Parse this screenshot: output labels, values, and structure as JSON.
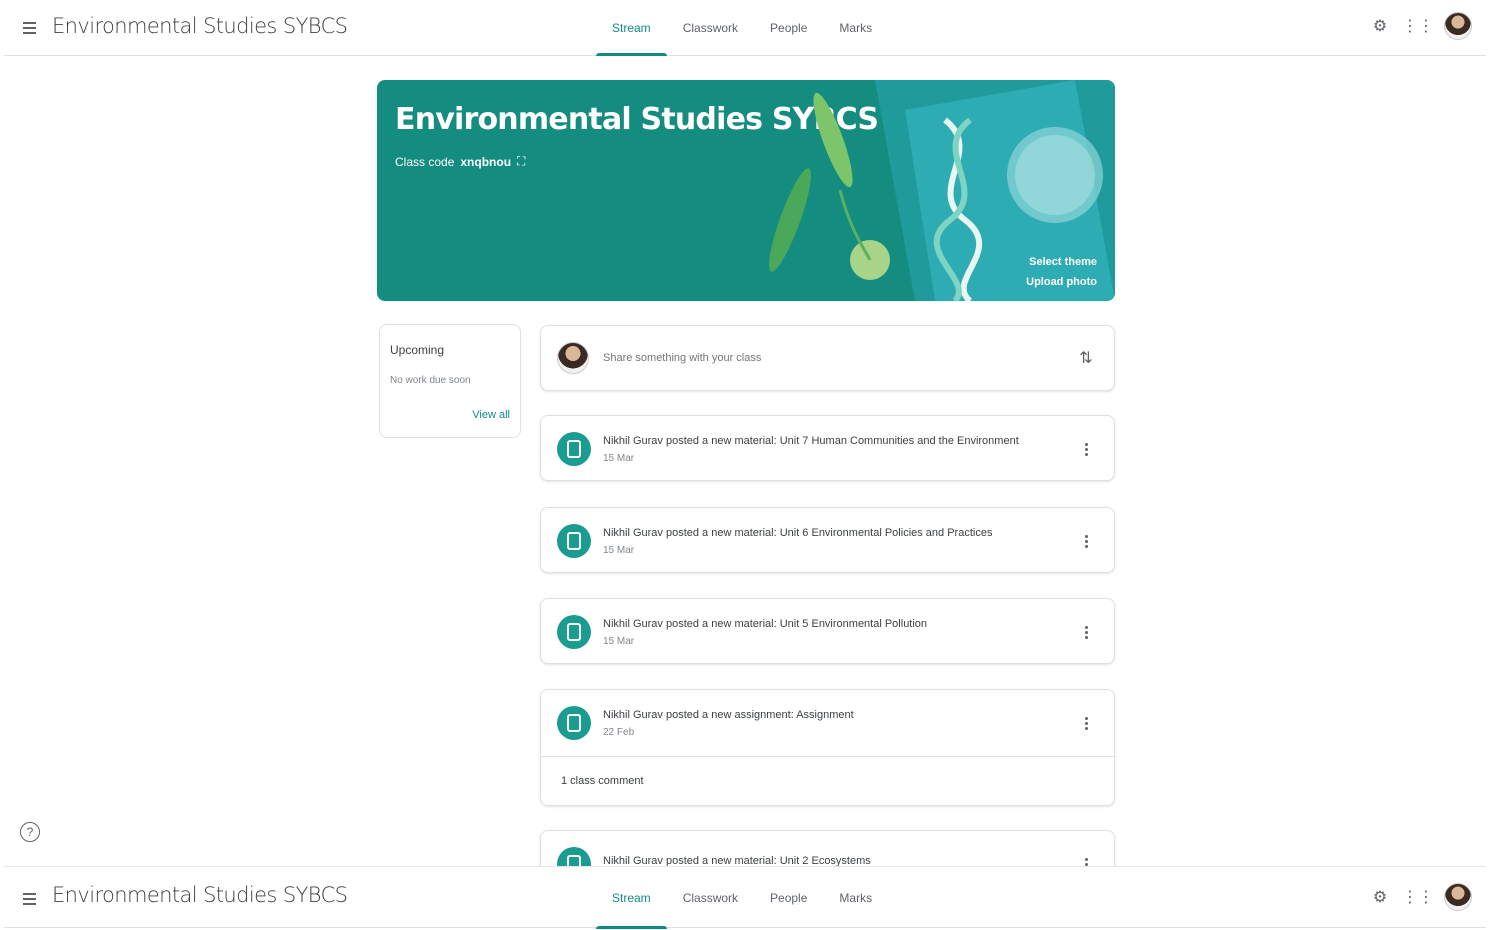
{
  "app": {
    "title": "Environmental Studies SYBCS"
  },
  "tabs": [
    {
      "label": "Stream"
    },
    {
      "label": "Classwork"
    },
    {
      "label": "People"
    },
    {
      "label": "Marks"
    }
  ],
  "banner": {
    "title": "Environmental Studies SYBCS",
    "class_code_label": "Class code",
    "class_code_value": "xnqbnou",
    "select_theme": "Select theme",
    "upload_photo": "Upload photo"
  },
  "upcoming": {
    "heading": "Upcoming",
    "empty_text": "No work due soon",
    "view_all": "View all"
  },
  "share": {
    "placeholder": "Share something with your class"
  },
  "posts": [
    {
      "title": "Nikhil Gurav posted a new material: Unit 7 Human Communities and the Environment",
      "date": "15 Mar"
    },
    {
      "title": "Nikhil Gurav posted a new material: Unit 6 Environmental Policies and Practices",
      "date": "15 Mar"
    },
    {
      "title": "Nikhil Gurav posted a new material: Unit 5 Environmental Pollution",
      "date": "15 Mar"
    },
    {
      "title": "Nikhil Gurav posted a new assignment: Assignment",
      "date": "22 Feb",
      "comment": "1 class comment"
    },
    {
      "title": "Nikhil Gurav posted a new material: Unit 2 Ecosystems",
      "date": ""
    }
  ],
  "colors": {
    "accent": "#128c80",
    "banner": "#148c80",
    "icon": "#1a9c8f"
  },
  "icons": {
    "menu": "menu-icon",
    "settings": "settings-icon",
    "apps": "apps-icon",
    "help": "help-icon"
  }
}
